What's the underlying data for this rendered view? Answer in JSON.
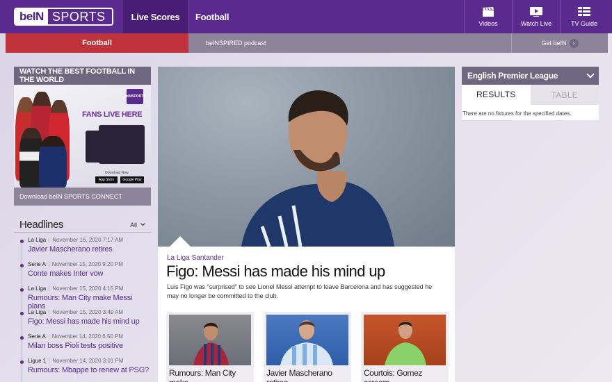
{
  "brand": {
    "logo_left": "beIN",
    "logo_right": "SPORTS"
  },
  "nav": {
    "live_scores": "Live Scores",
    "football": "Football",
    "tiles": [
      {
        "label": "Videos",
        "icon": "clapperboard-icon"
      },
      {
        "label": "Watch Live",
        "icon": "tv-play-icon"
      },
      {
        "label": "TV Guide",
        "icon": "list-grid-icon"
      }
    ]
  },
  "subnav": {
    "football": "Football",
    "podcast": "beINSPIRED podcast",
    "get_bein": "Get beIN",
    "arrow": "›"
  },
  "promo": {
    "title": "WATCH THE BEST FOOTBALL IN THE WORLD",
    "image_logo_top": "beIN",
    "image_logo_bottom": "SPORTS",
    "image_text": "FANS LIVE HERE",
    "download_now": "Download Now",
    "app_store": "App Store",
    "google_play": "Google Play",
    "footer": "Download beIN SPORTS CONNECT"
  },
  "headlines": {
    "title": "Headlines",
    "filter": "All",
    "items": [
      {
        "league": "La Liga",
        "time": "November 16, 2020 7:17 AM",
        "title": "Javier Mascherano retires"
      },
      {
        "league": "Serie A",
        "time": "November 15, 2020 9:20 PM",
        "title": "Conte makes Inter vow"
      },
      {
        "league": "La Liga",
        "time": "November 15, 2020 4:15 PM",
        "title": "Rumours: Man City make Messi plans"
      },
      {
        "league": "La Liga",
        "time": "November 15, 2020 3:49 AM",
        "title": "Figo: Messi has made his mind up"
      },
      {
        "league": "Serie A",
        "time": "November 14, 2020 6:50 PM",
        "title": "Milan boss Pioli tests positive"
      },
      {
        "league": "Ligue 1",
        "time": "November 14, 2020 3:01 PM",
        "title": "Rumours: Mbappe to renew at PSG?"
      }
    ]
  },
  "hero": {
    "category": "La Liga Santander",
    "title": "Figo: Messi has made his mind up",
    "description": "Luis Figo was \"surprised\" to see Lionel Messi attempt to leave Barcelona and has suggested he may no longer be committed to the club."
  },
  "cards": [
    {
      "caption": "Rumours: Man City make"
    },
    {
      "caption": "Javier Mascherano retires"
    },
    {
      "caption": "Courtois: Gomez scream"
    }
  ],
  "league": {
    "name": "English Premier League",
    "tab_results": "RESULTS",
    "tab_table": "TABLE",
    "message": "There are no fixtures for the specified dates."
  },
  "colors": {
    "brand_purple": "#5b2a8e",
    "active_red": "#c0333b",
    "panel_grey": "#8e8499",
    "link_purple": "#5b2a8e"
  }
}
